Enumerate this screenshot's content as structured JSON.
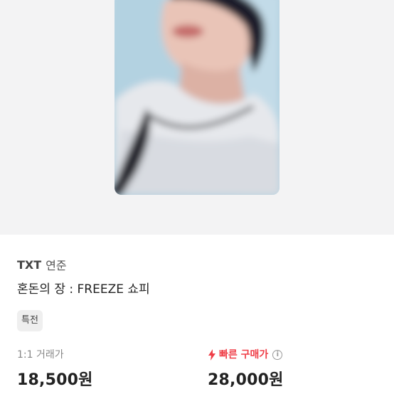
{
  "product": {
    "artist": "TXT",
    "member": "연준",
    "title": "혼돈의 장 : FREEZE 쇼피",
    "badge": "특전",
    "image_alt": "photocard"
  },
  "prices": {
    "trade_label": "1:1 거래가",
    "trade_price": "18,500원",
    "fast_label": "빠른 구매가",
    "fast_price": "28,000원"
  },
  "icons": {
    "fast": "bolt-icon",
    "info": "info-icon"
  },
  "colors": {
    "accent_red": "#ef3e47",
    "image_bg": "#f3f3f4"
  }
}
